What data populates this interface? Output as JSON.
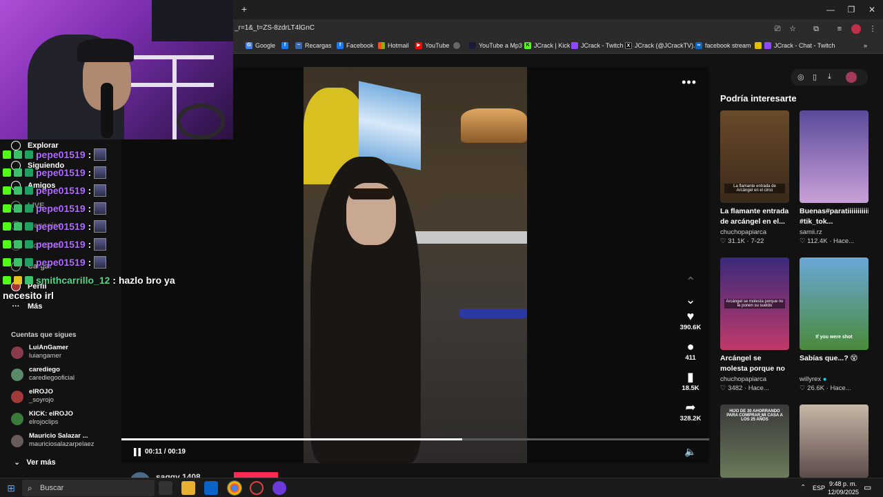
{
  "browser": {
    "url": "_r=1&_t=ZS-8zdrLT4lGnC",
    "bookmarks": [
      "Google",
      "Recargas",
      "Facebook",
      "Hotmail",
      "YouTube",
      "YouTube a Mp3",
      "JCrack | Kick",
      "JCrack - Twitch",
      "JCrack (@JCrackTV)...",
      "facebook stream",
      "JCrack - Chat - Twitch"
    ]
  },
  "sidebar": {
    "nav": [
      {
        "label": "Explorar"
      },
      {
        "label": "Siguiendo"
      },
      {
        "label": "Amigos"
      },
      {
        "label": "LIVE"
      },
      {
        "label": "Mensajes"
      },
      {
        "label": "Actividad"
      },
      {
        "label": "Cargar"
      },
      {
        "label": "Perfil"
      },
      {
        "label": "Más"
      }
    ],
    "following_title": "Cuentas que sigues",
    "accounts": [
      {
        "name": "LuiAnGamer",
        "handle": "luiangamer",
        "color": "#8a3b4a"
      },
      {
        "name": "carediego",
        "handle": "carediegooficial",
        "color": "#5a8a6a"
      },
      {
        "name": "elROJO",
        "handle": "_soyrojo",
        "color": "#a33a3a"
      },
      {
        "name": "KICK: elROJO",
        "handle": "elrojoclips",
        "color": "#3a7a3a"
      },
      {
        "name": "Mauricio Salazar ...",
        "handle": "mauriciosalazarpelaez",
        "color": "#6a5a5a"
      }
    ],
    "see_more": "Ver más"
  },
  "chat": {
    "lines": [
      {
        "user": "pepe01519",
        "sep": ":"
      },
      {
        "user": "pepe01519",
        "sep": ":"
      },
      {
        "user": "pepe01519",
        "sep": ":"
      },
      {
        "user": "pepe01519",
        "sep": ":"
      },
      {
        "user": "pepe01519",
        "sep": ":"
      },
      {
        "user": "pepe01519",
        "sep": ":"
      },
      {
        "user": "pepe01519",
        "sep": ":"
      }
    ],
    "last": {
      "user": "smithcarrillo_12",
      "message": ": hazlo bro ya",
      "continuation": "necesito irl"
    }
  },
  "video": {
    "actions": [
      {
        "icon": "heart-icon",
        "count": "390.6K"
      },
      {
        "icon": "comment-icon",
        "count": "411"
      },
      {
        "icon": "bookmark-icon",
        "count": "18.5K"
      },
      {
        "icon": "share-icon",
        "count": "328.2K"
      }
    ],
    "time": "00:11 / 00:19",
    "progress": 0.58,
    "author_peek": "saggy 1408"
  },
  "right": {
    "title": "Podría interesarte",
    "cards": [
      {
        "title": "La flamante entrada de arcángel en el...",
        "user": "chuchopapiarca",
        "likes": "31.1K",
        "date": "7-22",
        "caption": "La flamante entrada de Arcángel en el circo",
        "bg": "linear-gradient(180deg,#6a4a2a,#3a2a1a)"
      },
      {
        "title": "Buenas#paratiiiiiiiiiiiiiiiiiiiiiiiiiiiii #tik_tok...",
        "user": "samii.rz",
        "likes": "112.4K",
        "date": "Hace...",
        "caption": "",
        "bg": "linear-gradient(180deg,#5a4a9a,#c9a0d8)"
      },
      {
        "title": "Arcángel se molesta porque no le ponen...",
        "user": "chuchopapiarca",
        "likes": "3482",
        "date": "Hace...",
        "caption": "Arcángel se molesta porque no le ponen su sueldo",
        "bg": "linear-gradient(180deg,#3a2a7a,#c03a6a)"
      },
      {
        "title": "Sabías que...? 😵",
        "user": "willyrex",
        "likes": "26.6K",
        "date": "Hace...",
        "caption": "If you were shot",
        "bg": "linear-gradient(180deg,#6aa8d8,#4a8a3a)"
      },
      {
        "title": "",
        "user": "",
        "likes": "",
        "date": "",
        "caption": "HIJO DE 30 AHORRANDO PARA COMPRAR MI CASA A LOS 25 AÑOS",
        "bg": "linear-gradient(180deg,#3a3a3a,#6a7a5a)"
      },
      {
        "title": "",
        "user": "",
        "likes": "",
        "date": "",
        "caption": "",
        "bg": "linear-gradient(180deg,#c8b8a8,#5a4a4a)"
      }
    ]
  },
  "taskbar": {
    "search_placeholder": "Buscar",
    "language": "ESP",
    "time": "9:48 p. m.",
    "date": "12/09/2025"
  }
}
